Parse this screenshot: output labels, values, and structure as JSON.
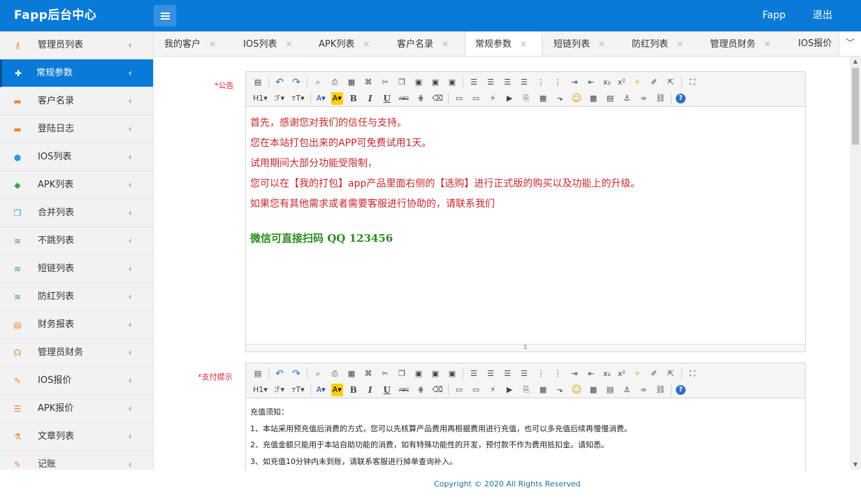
{
  "header": {
    "brand": "Fapp后台中心",
    "user": "Fapp",
    "logout": "退出",
    "accent": "#0a7ad8"
  },
  "sidebar": {
    "items": [
      {
        "label": "管理员列表",
        "icon": "key-icon",
        "glyph": "⚷",
        "color": "#e8893a"
      },
      {
        "label": "常规参数",
        "icon": "plus-icon",
        "glyph": "✚",
        "color": "#e8893a",
        "active": true
      },
      {
        "label": "客户名录",
        "icon": "briefcase-icon",
        "glyph": "▬",
        "color": "#e8893a"
      },
      {
        "label": "登陆日志",
        "icon": "briefcase-icon",
        "glyph": "▬",
        "color": "#e8893a"
      },
      {
        "label": "IOS列表",
        "icon": "apple-icon",
        "glyph": "●",
        "color": "#2a9ae0"
      },
      {
        "label": "APK列表",
        "icon": "android-icon",
        "glyph": "◆",
        "color": "#43a047"
      },
      {
        "label": "合并列表",
        "icon": "copy-icon",
        "glyph": "❐",
        "color": "#2a9ae0"
      },
      {
        "label": "不跳列表",
        "icon": "rss-icon",
        "glyph": "≋",
        "color": "#43a047"
      },
      {
        "label": "短链列表",
        "icon": "rss-icon",
        "glyph": "≋",
        "color": "#43a047"
      },
      {
        "label": "防红列表",
        "icon": "rss-icon",
        "glyph": "≋",
        "color": "#43a047"
      },
      {
        "label": "财务报表",
        "icon": "files-icon",
        "glyph": "▤",
        "color": "#e8893a"
      },
      {
        "label": "管理员财务",
        "icon": "stethoscope-icon",
        "glyph": "☊",
        "color": "#e8893a"
      },
      {
        "label": "IOS报价",
        "icon": "pencil-icon",
        "glyph": "✎",
        "color": "#e8893a"
      },
      {
        "label": "APK报价",
        "icon": "bars-icon",
        "glyph": "☰",
        "color": "#e8893a"
      },
      {
        "label": "文章列表",
        "icon": "flask-icon",
        "glyph": "⚗",
        "color": "#e8893a"
      },
      {
        "label": "记账",
        "icon": "pencil-icon",
        "glyph": "✎",
        "color": "#e8893a"
      }
    ]
  },
  "tabs": [
    {
      "label": "我的客户"
    },
    {
      "label": "IOS列表"
    },
    {
      "label": "APK列表"
    },
    {
      "label": "客户名录"
    },
    {
      "label": "常规参数",
      "active": true
    },
    {
      "label": "短链列表"
    },
    {
      "label": "防红列表"
    },
    {
      "label": "管理员财务"
    },
    {
      "label": "IOS报价"
    }
  ],
  "form": {
    "notice": {
      "label": "*公告",
      "lines": [
        "首先，感谢您对我们的信任与支持。",
        "您在本站打包出来的APP可免费试用1天。",
        "试用期间大部分功能受限制，",
        "您可以在【我的打包】app产品里面右侧的【选购】进行正式版的购买以及功能上的升级。",
        "如果您有其他需求或者需要客服进行协助的，请联系我们"
      ],
      "highlight": "微信可直接扫码  QQ 123456"
    },
    "pay_tip": {
      "label": "*支付提示",
      "lines": [
        "充值须知：",
        "1、本站采用预充值后消费的方式，您可以先核算产品费用再根据费用进行充值，也可以多充值后续再慢慢消费。",
        "2、充值金额只能用于本站自助功能的消费，如有特殊功能性的开发，预付款不作为费用抵扣金。请知悉。",
        "3、如充值10分钟内未到账，请联系客服进行掉单查询补入。"
      ]
    }
  },
  "toolbar": {
    "row1": [
      "source-icon",
      "|",
      "undo-icon",
      "redo-icon",
      "|",
      "preview-icon",
      "print-icon",
      "template-icon",
      "code-icon",
      "cut-icon",
      "copy-icon",
      "paste-icon",
      "paste-text-icon",
      "paste-word-icon",
      "|",
      "align-left-icon",
      "align-center-icon",
      "align-right-icon",
      "align-justify-icon",
      "ordered-list-icon",
      "unordered-list-icon",
      "indent-icon",
      "outdent-icon",
      "subscript-icon",
      "superscript-icon",
      "clear-format-icon",
      "select-all-icon",
      "cursor-icon",
      "|",
      "fullscreen-icon"
    ],
    "row2": [
      "heading-icon",
      "font-family-icon",
      "font-size-icon",
      "|",
      "font-color-icon",
      "highlight-icon",
      "bold-icon",
      "italic-icon",
      "underline-icon",
      "strikethrough-icon",
      "line-height-icon",
      "eraser-icon",
      "|",
      "image-icon",
      "multi-image-icon",
      "flash-icon",
      "media-icon",
      "attachment-icon",
      "table-icon",
      "insert-hr-icon",
      "emoticon-icon",
      "map-icon",
      "pagebreak-icon",
      "anchor-icon",
      "link-icon",
      "unlink-icon",
      "|",
      "help-icon"
    ]
  },
  "footer": {
    "text": "Copyright © 2020 All Rights Reserved"
  }
}
